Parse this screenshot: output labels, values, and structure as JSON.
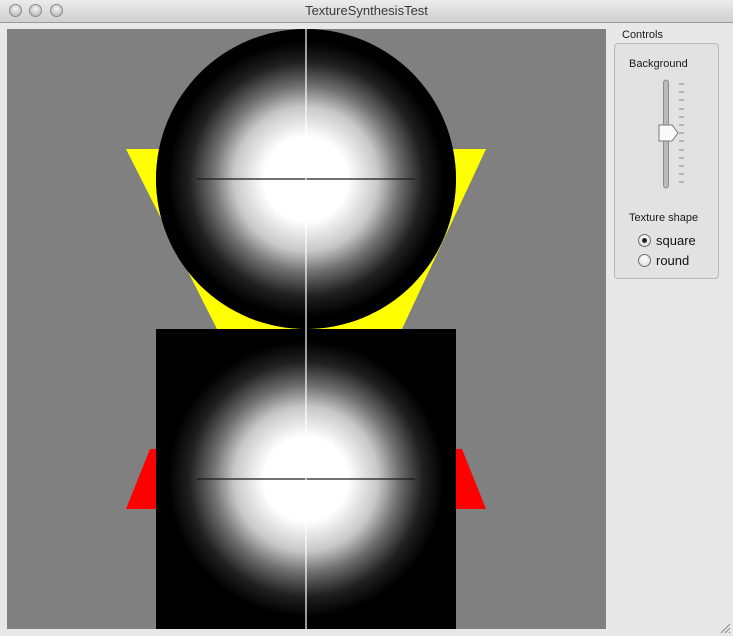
{
  "window": {
    "title": "TextureSynthesisTest"
  },
  "canvas": {
    "background_color": "#808080",
    "top_figure": {
      "shape": "circle",
      "triangle_color": "#ffff00"
    },
    "bottom_figure": {
      "shape": "square",
      "triangle_color": "#ff0000"
    }
  },
  "controls": {
    "group_label": "Controls",
    "background_label": "Background",
    "background_slider": {
      "min": 0,
      "max": 1,
      "value": 0.5
    },
    "texture_shape_label": "Texture shape",
    "texture_shape_options": [
      {
        "label": "square",
        "selected": true
      },
      {
        "label": "round",
        "selected": false
      }
    ]
  }
}
